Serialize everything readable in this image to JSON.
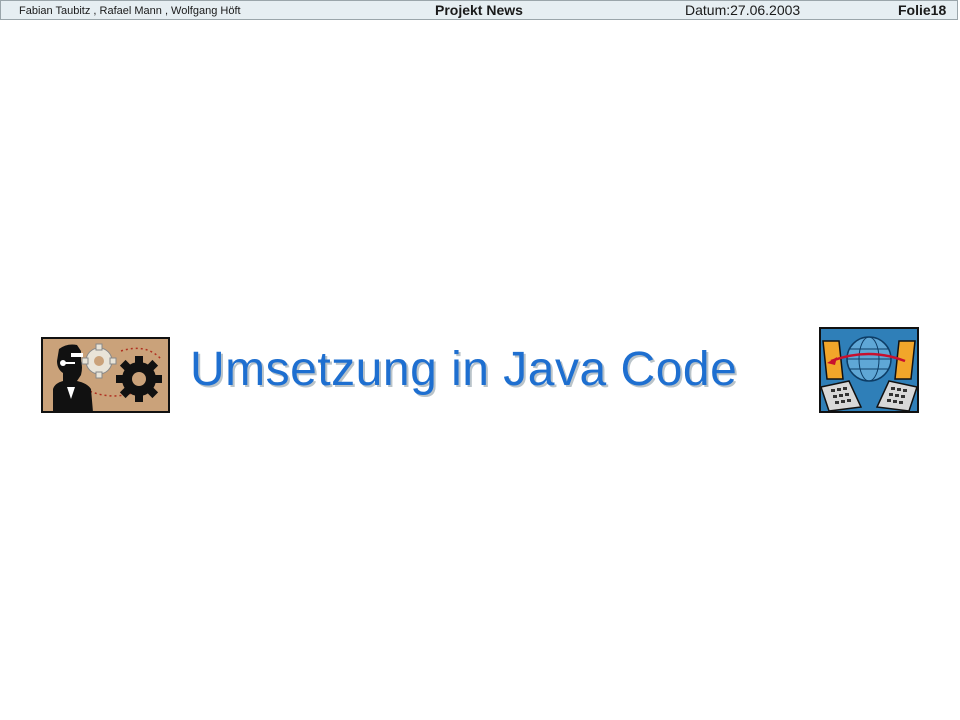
{
  "header": {
    "authors": "Fabian Taubitz , Rafael Mann , Wolfgang Höft",
    "project": "Projekt News",
    "date": "Datum:27.06.2003",
    "slide": "Folie18"
  },
  "slide": {
    "title": "Umsetzung in Java Code"
  },
  "images": {
    "left_icon": "person-gears-clipart",
    "right_icon": "computers-globe-clipart"
  },
  "colors": {
    "title": "#1e6fd0",
    "header_bg": "#e6eef2",
    "clip_left_bg": "#caa27a",
    "clip_right_bg": "#2f7fb8"
  }
}
